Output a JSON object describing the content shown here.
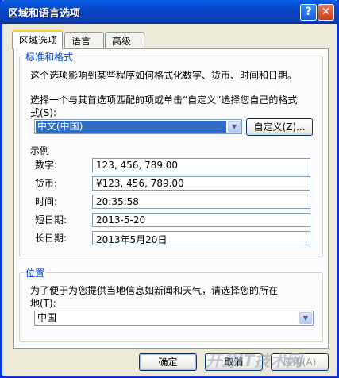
{
  "window": {
    "title": "区域和语言选项",
    "help_glyph": "?",
    "close_glyph": "✕"
  },
  "tabs": [
    {
      "label": "区域选项",
      "active": true
    },
    {
      "label": "语言",
      "active": false
    },
    {
      "label": "高级",
      "active": false
    }
  ],
  "standards": {
    "legend": "标准和格式",
    "description": "这个选项影响到某些程序如何格式化数字、货币、时间和日期。",
    "instruction_line1": "选择一个与其首选项匹配的项或单击“自定义”选择您自己的格式",
    "instruction_line2": "式(S):",
    "locale_value": "中文(中国)",
    "customize_button": "自定义(Z)...",
    "samples_heading": "示例",
    "samples": [
      {
        "label": "数字:",
        "value": "123, 456, 789.00"
      },
      {
        "label": "货币:",
        "value": "¥123, 456, 789.00"
      },
      {
        "label": "时间:",
        "value": "20:35:58"
      },
      {
        "label": "短日期:",
        "value": "2013-5-20"
      },
      {
        "label": "长日期:",
        "value": "2013年5月20日"
      }
    ]
  },
  "location": {
    "legend": "位置",
    "description_line1": "为了便于为您提供当地信息如新闻和天气，请选择您的所在",
    "description_line2": "地(T):",
    "value": "中国"
  },
  "buttons": {
    "ok": "确定",
    "cancel": "取消",
    "apply": "应用(A)"
  },
  "watermark": "开源IT技术网"
}
